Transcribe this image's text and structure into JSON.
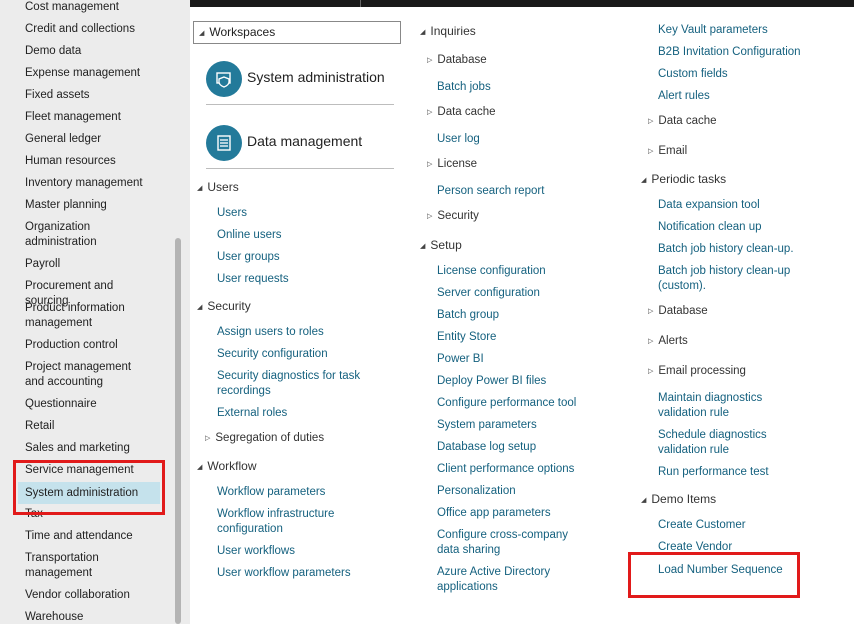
{
  "sidebar": {
    "items": [
      "Cost management",
      "Credit and collections",
      "Demo data",
      "Expense management",
      "Fixed assets",
      "Fleet management",
      "General ledger",
      "Human resources",
      "Inventory management",
      "Master planning",
      "Organization administration",
      "Payroll",
      "Procurement and sourcing",
      "Product information management",
      "Production control",
      "Project management and accounting",
      "Questionnaire",
      "Retail",
      "Sales and marketing",
      "Service management",
      "System administration",
      "Tax",
      "Time and attendance",
      "Transportation management",
      "Vendor collaboration",
      "Warehouse management"
    ],
    "selected": "System administration"
  },
  "workspaces": {
    "header": "Workspaces",
    "tiles": [
      "System administration",
      "Data management"
    ]
  },
  "col1": {
    "users": {
      "header": "Users",
      "links": [
        "Users",
        "Online users",
        "User groups",
        "User requests"
      ]
    },
    "security": {
      "header": "Security",
      "links": [
        "Assign users to roles",
        "Security configuration",
        "Security diagnostics for task recordings",
        "External roles"
      ],
      "collapsed": "Segregation of duties"
    },
    "workflow": {
      "header": "Workflow",
      "links": [
        "Workflow parameters",
        "Workflow infrastructure configuration",
        "User workflows",
        "User workflow parameters"
      ]
    }
  },
  "col2": {
    "inquiries": {
      "header": "Inquiries",
      "entries": [
        {
          "label": "Database",
          "collapsed": true
        },
        {
          "label": "Batch jobs",
          "collapsed": false
        },
        {
          "label": "Data cache",
          "collapsed": true
        },
        {
          "label": "User log",
          "collapsed": false
        },
        {
          "label": "License",
          "collapsed": true
        },
        {
          "label": "Person search report",
          "collapsed": false
        },
        {
          "label": "Security",
          "collapsed": true
        }
      ]
    },
    "setup": {
      "header": "Setup",
      "links": [
        "License configuration",
        "Server configuration",
        "Batch group",
        "Entity Store",
        "Power BI",
        "Deploy Power BI files",
        "Configure performance tool",
        "System parameters",
        "Database log setup",
        "Client performance options",
        "Personalization",
        "Office app parameters",
        "Configure cross-company data sharing",
        "Azure Active Directory applications"
      ]
    }
  },
  "col3": {
    "top_links": [
      "Key Vault parameters",
      "B2B Invitation Configuration",
      "Custom fields",
      "Alert rules"
    ],
    "collapsed_a": [
      "Data cache",
      "Email"
    ],
    "periodic": {
      "header": "Periodic tasks",
      "links": [
        "Data expansion tool",
        "Notification clean up",
        "Batch job history clean-up.",
        "Batch job history clean-up (custom)."
      ],
      "collapsed": [
        "Database",
        "Alerts",
        "Email processing"
      ],
      "links2": [
        "Maintain diagnostics validation rule",
        "Schedule diagnostics validation rule",
        "Run performance test"
      ]
    },
    "demo": {
      "header": "Demo Items",
      "links": [
        "Create Customer",
        "Create Vendor",
        "Load Number Sequence"
      ]
    }
  },
  "colors": {
    "link": "#15617f",
    "tile": "#237a9a",
    "highlight": "#e11a1a",
    "selected": "#c5e2ec"
  },
  "icons": {
    "expanded": "triangle-down-icon",
    "collapsed": "triangle-right-icon"
  }
}
